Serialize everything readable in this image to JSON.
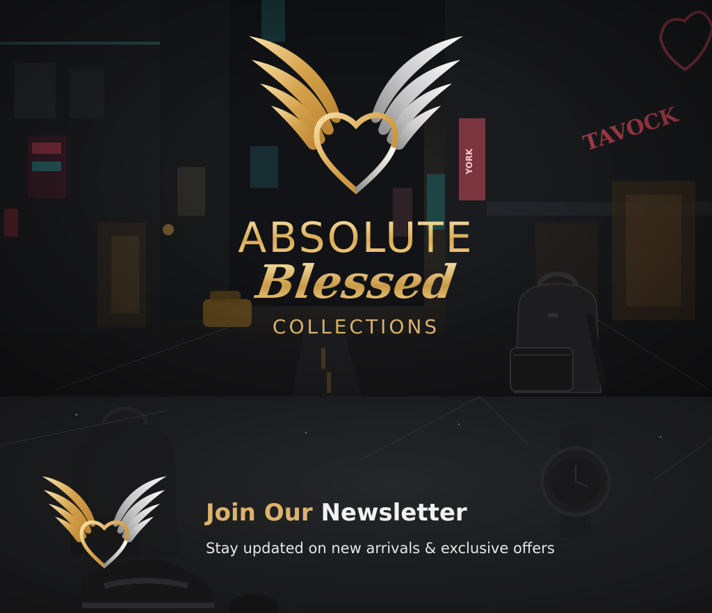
{
  "hero": {
    "brand_name": "ABSOLUTE",
    "brand_script": "Blessed",
    "brand_sub": "COLLECTIONS",
    "street_signs": [
      "YORK",
      "TAVOCK"
    ]
  },
  "newsletter": {
    "title_accent": "Join Our",
    "title_plain": "Newsletter",
    "subtitle": "Stay updated on new arrivals & exclusive offers"
  },
  "icons": {
    "brand_emblem": "winged-heart-icon",
    "backpack": "backpack-icon",
    "watch": "watch-icon",
    "sneaker": "sneaker-icon"
  },
  "colors": {
    "gold": "#dcb36a",
    "silver": "#cfcfcf",
    "background": "#1c1d1f",
    "text": "#f1f1f1"
  }
}
